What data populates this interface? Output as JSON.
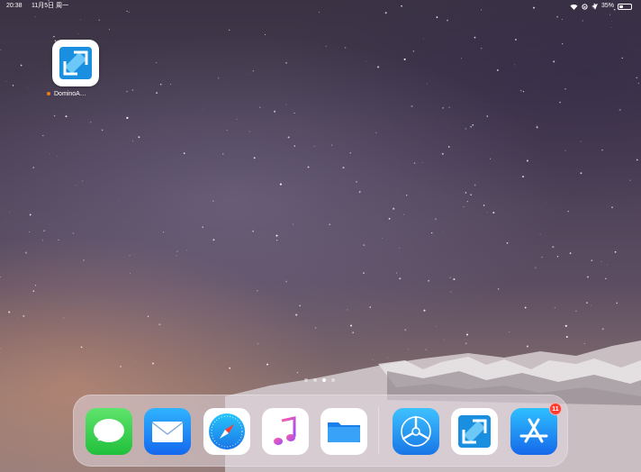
{
  "status_bar": {
    "time": "20:38",
    "date": "11月5日 周一",
    "battery_text": "35%",
    "battery_level": 0.35,
    "icons": [
      "wifi-icon",
      "orientation-lock-icon",
      "location-arrow-icon",
      "battery-icon"
    ]
  },
  "home_screen": {
    "apps": [
      {
        "label": "DominoA…",
        "icon": "domino-app-icon",
        "update_dot_color": "#f07a1a"
      }
    ],
    "page_count": 4,
    "current_page": 3
  },
  "dock": {
    "apps": [
      {
        "name": "messages",
        "icon": "messages-icon"
      },
      {
        "name": "mail",
        "icon": "mail-icon"
      },
      {
        "name": "safari",
        "icon": "safari-icon"
      },
      {
        "name": "music",
        "icon": "music-icon"
      },
      {
        "name": "files",
        "icon": "files-icon"
      }
    ],
    "recent_apps": [
      {
        "name": "testflight",
        "icon": "testflight-icon"
      },
      {
        "name": "domino",
        "icon": "domino-app-icon"
      },
      {
        "name": "app-store",
        "icon": "app-store-icon",
        "badge": "11"
      }
    ]
  },
  "colors": {
    "badge": "#ff3b30",
    "messages_green": "#38c84f",
    "mail_blue": "#1e8af5",
    "app_store_blue": "#1d9bf5"
  }
}
